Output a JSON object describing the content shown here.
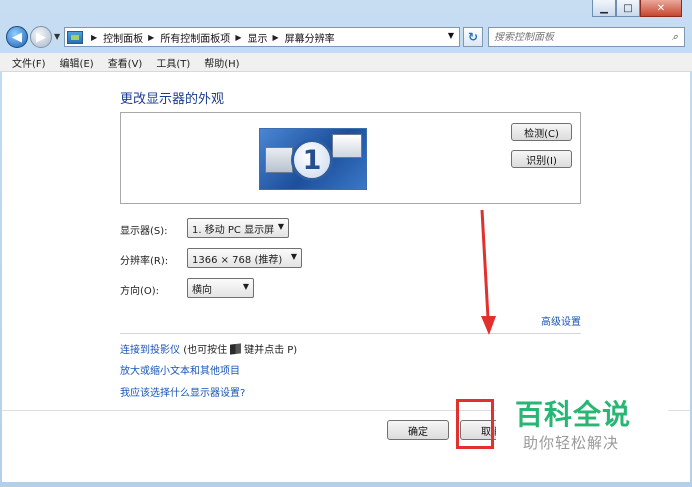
{
  "window": {
    "minimize": "▁",
    "maximize": "□",
    "close": "✕"
  },
  "address": {
    "crumbs": [
      "控制面板",
      "所有控制面板项",
      "显示",
      "屏幕分辨率"
    ],
    "search_placeholder": "搜索控制面板"
  },
  "menu": [
    "文件(F)",
    "编辑(E)",
    "查看(V)",
    "工具(T)",
    "帮助(H)"
  ],
  "main": {
    "title": "更改显示器的外观",
    "monitor_number": "1",
    "detect_label": "检测(C)",
    "identify_label": "识别(I)",
    "display_label": "显示器(S):",
    "display_value": "1. 移动 PC 显示屏",
    "resolution_label": "分辨率(R):",
    "resolution_value": "1366 × 768 (推荐)",
    "orientation_label": "方向(O):",
    "orientation_value": "横向",
    "advanced_link": "高级设置",
    "projector_link": "连接到投影仪",
    "projector_hint_a": "(也可按住",
    "projector_hint_b": "键并点击 P)",
    "textsize_link": "放大或缩小文本和其他项目",
    "which_settings_link": "我应该选择什么显示器设置?",
    "ok_label": "确定",
    "cancel_label": "取消"
  },
  "watermark": {
    "title": "百科全说",
    "subtitle": "助你轻松解决"
  },
  "colors": {
    "annotation_red": "#e2302f",
    "link_blue": "#1a55b8",
    "title_blue": "#1b3d8f",
    "watermark_green": "#27b673"
  }
}
